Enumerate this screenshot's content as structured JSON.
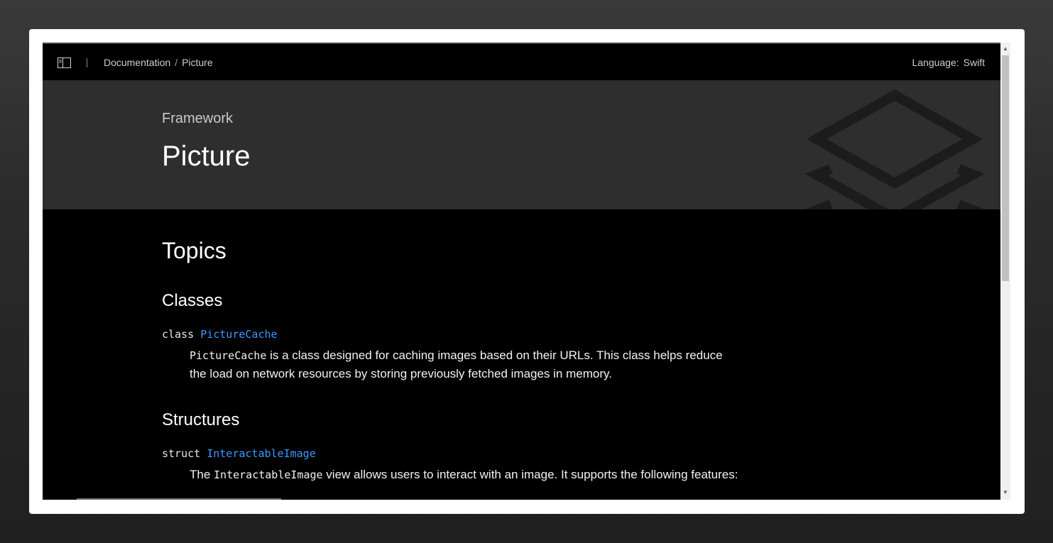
{
  "header": {
    "breadcrumb": [
      "Documentation",
      "Picture"
    ],
    "breadcrumb_separator": "/",
    "language_label": "Language:",
    "language_value": "Swift"
  },
  "hero": {
    "eyebrow": "Framework",
    "title": "Picture"
  },
  "topics": {
    "title": "Topics",
    "sections": [
      {
        "title": "Classes",
        "keyword": "class",
        "symbol": "PictureCache",
        "abstract_code": "PictureCache",
        "abstract_rest_line1": " is a class designed for caching images based on their URLs. This class helps reduce",
        "abstract_line2": "the load on network resources by storing previously fetched images in memory."
      },
      {
        "title": "Structures",
        "keyword": "struct",
        "symbol": "InteractableImage",
        "abstract_prefix": "The ",
        "abstract_code": "InteractableImage",
        "abstract_rest": " view allows users to interact with an image. It supports the following features:"
      }
    ]
  },
  "colors": {
    "background": "#000000",
    "hero_background": "#2e2e2e",
    "link": "#3a9bff",
    "text": "#ffffff"
  },
  "icons": {
    "sidebar_toggle": "sidebar-toggle-icon",
    "hero_graphic": "layers-icon"
  }
}
